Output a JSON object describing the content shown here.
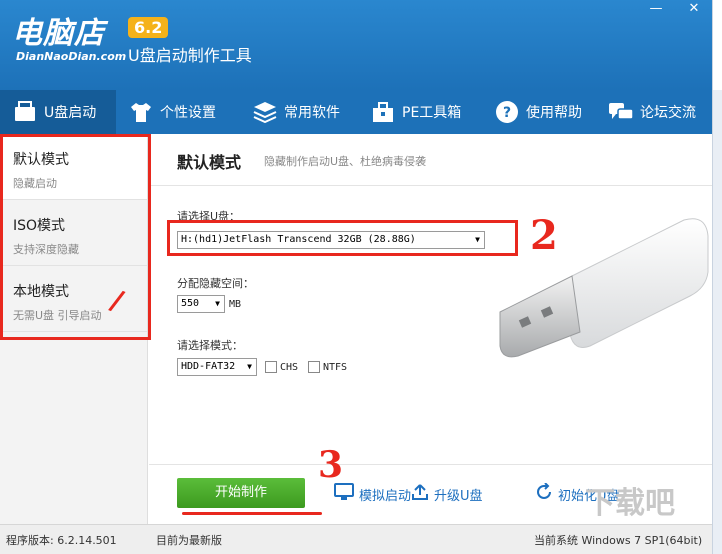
{
  "app": {
    "logo": "电脑店",
    "logo_en": "DianNaoDian.com",
    "version": "6.2",
    "subtitle": "U盘启动制作工具",
    "window_controls": [
      "—",
      "✕"
    ]
  },
  "topnav": [
    {
      "label": "U盘启动",
      "icon": "usb-icon",
      "active": true
    },
    {
      "label": "个性设置",
      "icon": "tshirt-icon",
      "active": false
    },
    {
      "label": "常用软件",
      "icon": "layers-icon",
      "active": false
    },
    {
      "label": "PE工具箱",
      "icon": "toolbox-icon",
      "active": false
    },
    {
      "label": "使用帮助",
      "icon": "help-icon",
      "active": false
    },
    {
      "label": "论坛交流",
      "icon": "chat-icon",
      "active": false
    }
  ],
  "sidebar": [
    {
      "title": "默认模式",
      "sub": "隐藏启动"
    },
    {
      "title": "ISO模式",
      "sub": "支持深度隐藏"
    },
    {
      "title": "本地模式",
      "sub": "无需U盘 引导启动"
    }
  ],
  "content": {
    "title": "默认模式",
    "subtitle": "隐藏制作启动U盘、杜绝病毒侵袭",
    "disk_label": "请选择U盘：",
    "disk_value": "H:(hd1)JetFlash Transcend 32GB (28.88G)",
    "partition_label": "分配隐藏空间：",
    "partition_value": "550",
    "partition_unit": "MB",
    "mode_label": "请选择模式：",
    "mode_value": "HDD-FAT32",
    "chs_label": "CHS",
    "ntfs_label": "NTFS"
  },
  "actions": {
    "start": "开始制作",
    "simulate": "模拟启动",
    "upgrade": "升级U盘",
    "init": "初始化U盘"
  },
  "status": {
    "version": "程序版本: 6.2.14.501",
    "latest": "目前为最新版",
    "system": "当前系统 Windows 7 SP1(64bit)"
  },
  "annotations": {
    "mark1": "/",
    "mark2": "2",
    "mark3": "3"
  },
  "watermark": "下载吧",
  "colors": {
    "brand_blue": "#1d71b8",
    "start_green": "#4aa82a",
    "annotation_red": "#e8281e",
    "version_badge": "#f5b21a"
  }
}
